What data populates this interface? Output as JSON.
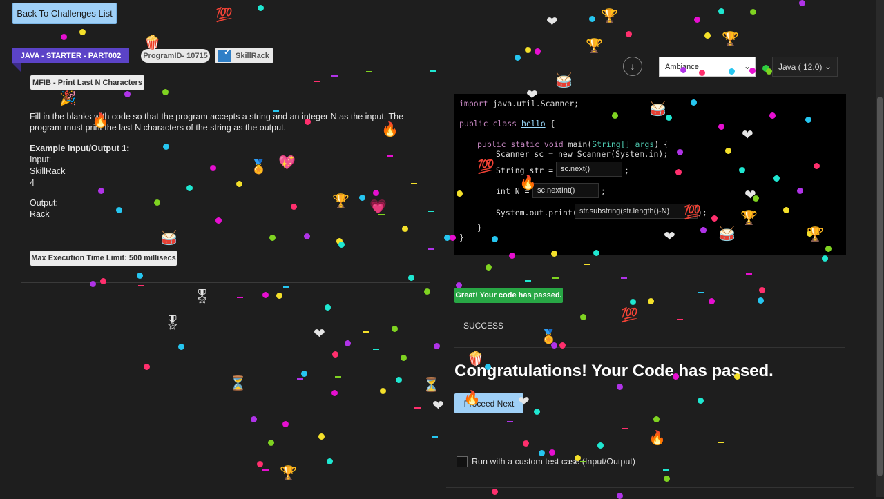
{
  "header": {
    "back_label": "Back To Challenges List",
    "course_label": "JAVA - STARTER - PART002",
    "program_id": "ProgramID- 10715",
    "brand": "SkillRack"
  },
  "problem": {
    "title": "MFIB - Print Last N Characters",
    "description": "Fill in the blanks with code so that the program accepts a string and an integer N as the input. The program must print the last N characters of the string as the output.",
    "example_heading": "Example Input/Output 1:",
    "input_label": "Input:",
    "input_lines": [
      "SkillRack",
      "4"
    ],
    "output_label": "Output:",
    "output_value": "Rack",
    "time_limit": "Max Execution Time Limit: 500 millisecs"
  },
  "editor": {
    "theme_value": "Ambiance",
    "language_value": "Java ( 12.0)",
    "code": {
      "l1a": "import",
      "l1b": " java.util.Scanner;",
      "l2a": "public class ",
      "l2b": "hello",
      "l2c": " {",
      "l3a": "public static void ",
      "l3b": "main(",
      "l3c": "String[] args",
      "l3d": ") {",
      "l4": "Scanner sc = new Scanner(System.in);",
      "l5": "String str = ",
      "l6": "int N = ",
      "l7": "System.out.print(",
      "semi": ";",
      "semi_close": ");",
      "close_inner": "}",
      "close_outer": "}"
    },
    "blanks": [
      "sc.next()",
      "sc.nextInt()",
      "str.substring(str.length()-N)"
    ]
  },
  "result": {
    "badge": "Great! Your code has passed.",
    "status": "SUCCESS",
    "congrats": "Congratulations! Your Code has passed.",
    "proceed_label": "Proceed Next",
    "custom_test_label": "Run with a custom test case (Input/Output)"
  }
}
